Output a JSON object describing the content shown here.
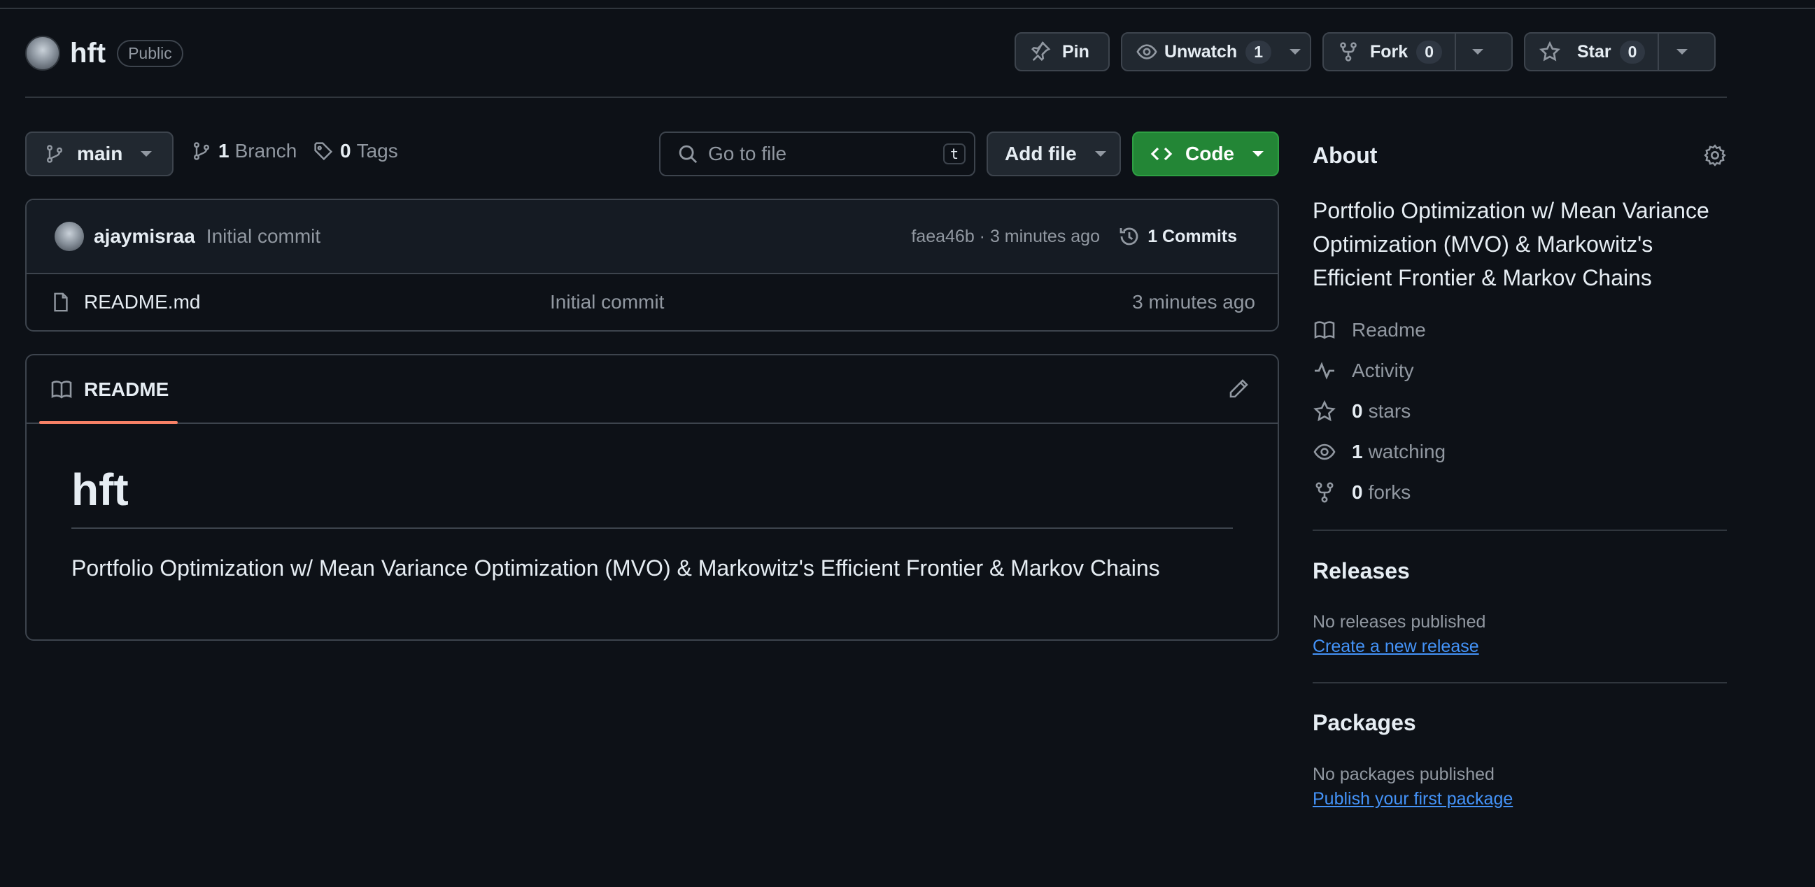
{
  "repo": {
    "name": "hft",
    "visibility": "Public"
  },
  "header_actions": {
    "pin_label": "Pin",
    "unwatch_label": "Unwatch",
    "watch_count": "1",
    "fork_label": "Fork",
    "fork_count": "0",
    "star_label": "Star",
    "star_count": "0"
  },
  "toolbar": {
    "branch": "main",
    "branches_count": "1",
    "branches_label": "Branch",
    "tags_count": "0",
    "tags_label": "Tags",
    "search_placeholder": "Go to file",
    "search_shortcut": "t",
    "add_file_label": "Add file",
    "code_label": "Code"
  },
  "latest_commit": {
    "author": "ajaymisraa",
    "message": "Initial commit",
    "meta": "faea46b · 3 minutes ago",
    "commits_label": "1 Commits"
  },
  "files": [
    {
      "name": "README.md",
      "message": "Initial commit",
      "age": "3 minutes ago"
    }
  ],
  "readme": {
    "tab_label": "README",
    "heading": "hft",
    "body": "Portfolio Optimization w/ Mean Variance Optimization (MVO) & Markowitz's Efficient Frontier & Markov Chains"
  },
  "about": {
    "title": "About",
    "description": "Portfolio Optimization w/ Mean Variance Optimization (MVO) & Markowitz's Efficient Frontier & Markov Chains",
    "items": [
      {
        "icon": "book-icon",
        "count": "",
        "label": "Readme"
      },
      {
        "icon": "pulse-icon",
        "count": "",
        "label": "Activity"
      },
      {
        "icon": "star-icon",
        "count": "0",
        "label": "stars"
      },
      {
        "icon": "eye-icon",
        "count": "1",
        "label": "watching"
      },
      {
        "icon": "fork-icon",
        "count": "0",
        "label": "forks"
      }
    ]
  },
  "releases": {
    "title": "Releases",
    "empty_text": "No releases published",
    "link": "Create a new release"
  },
  "packages": {
    "title": "Packages",
    "empty_text": "No packages published",
    "link": "Publish your first package"
  },
  "colors": {
    "accent_green": "#238636",
    "link_blue": "#4493f8",
    "tab_underline": "#f78166",
    "background": "#0d1117"
  }
}
